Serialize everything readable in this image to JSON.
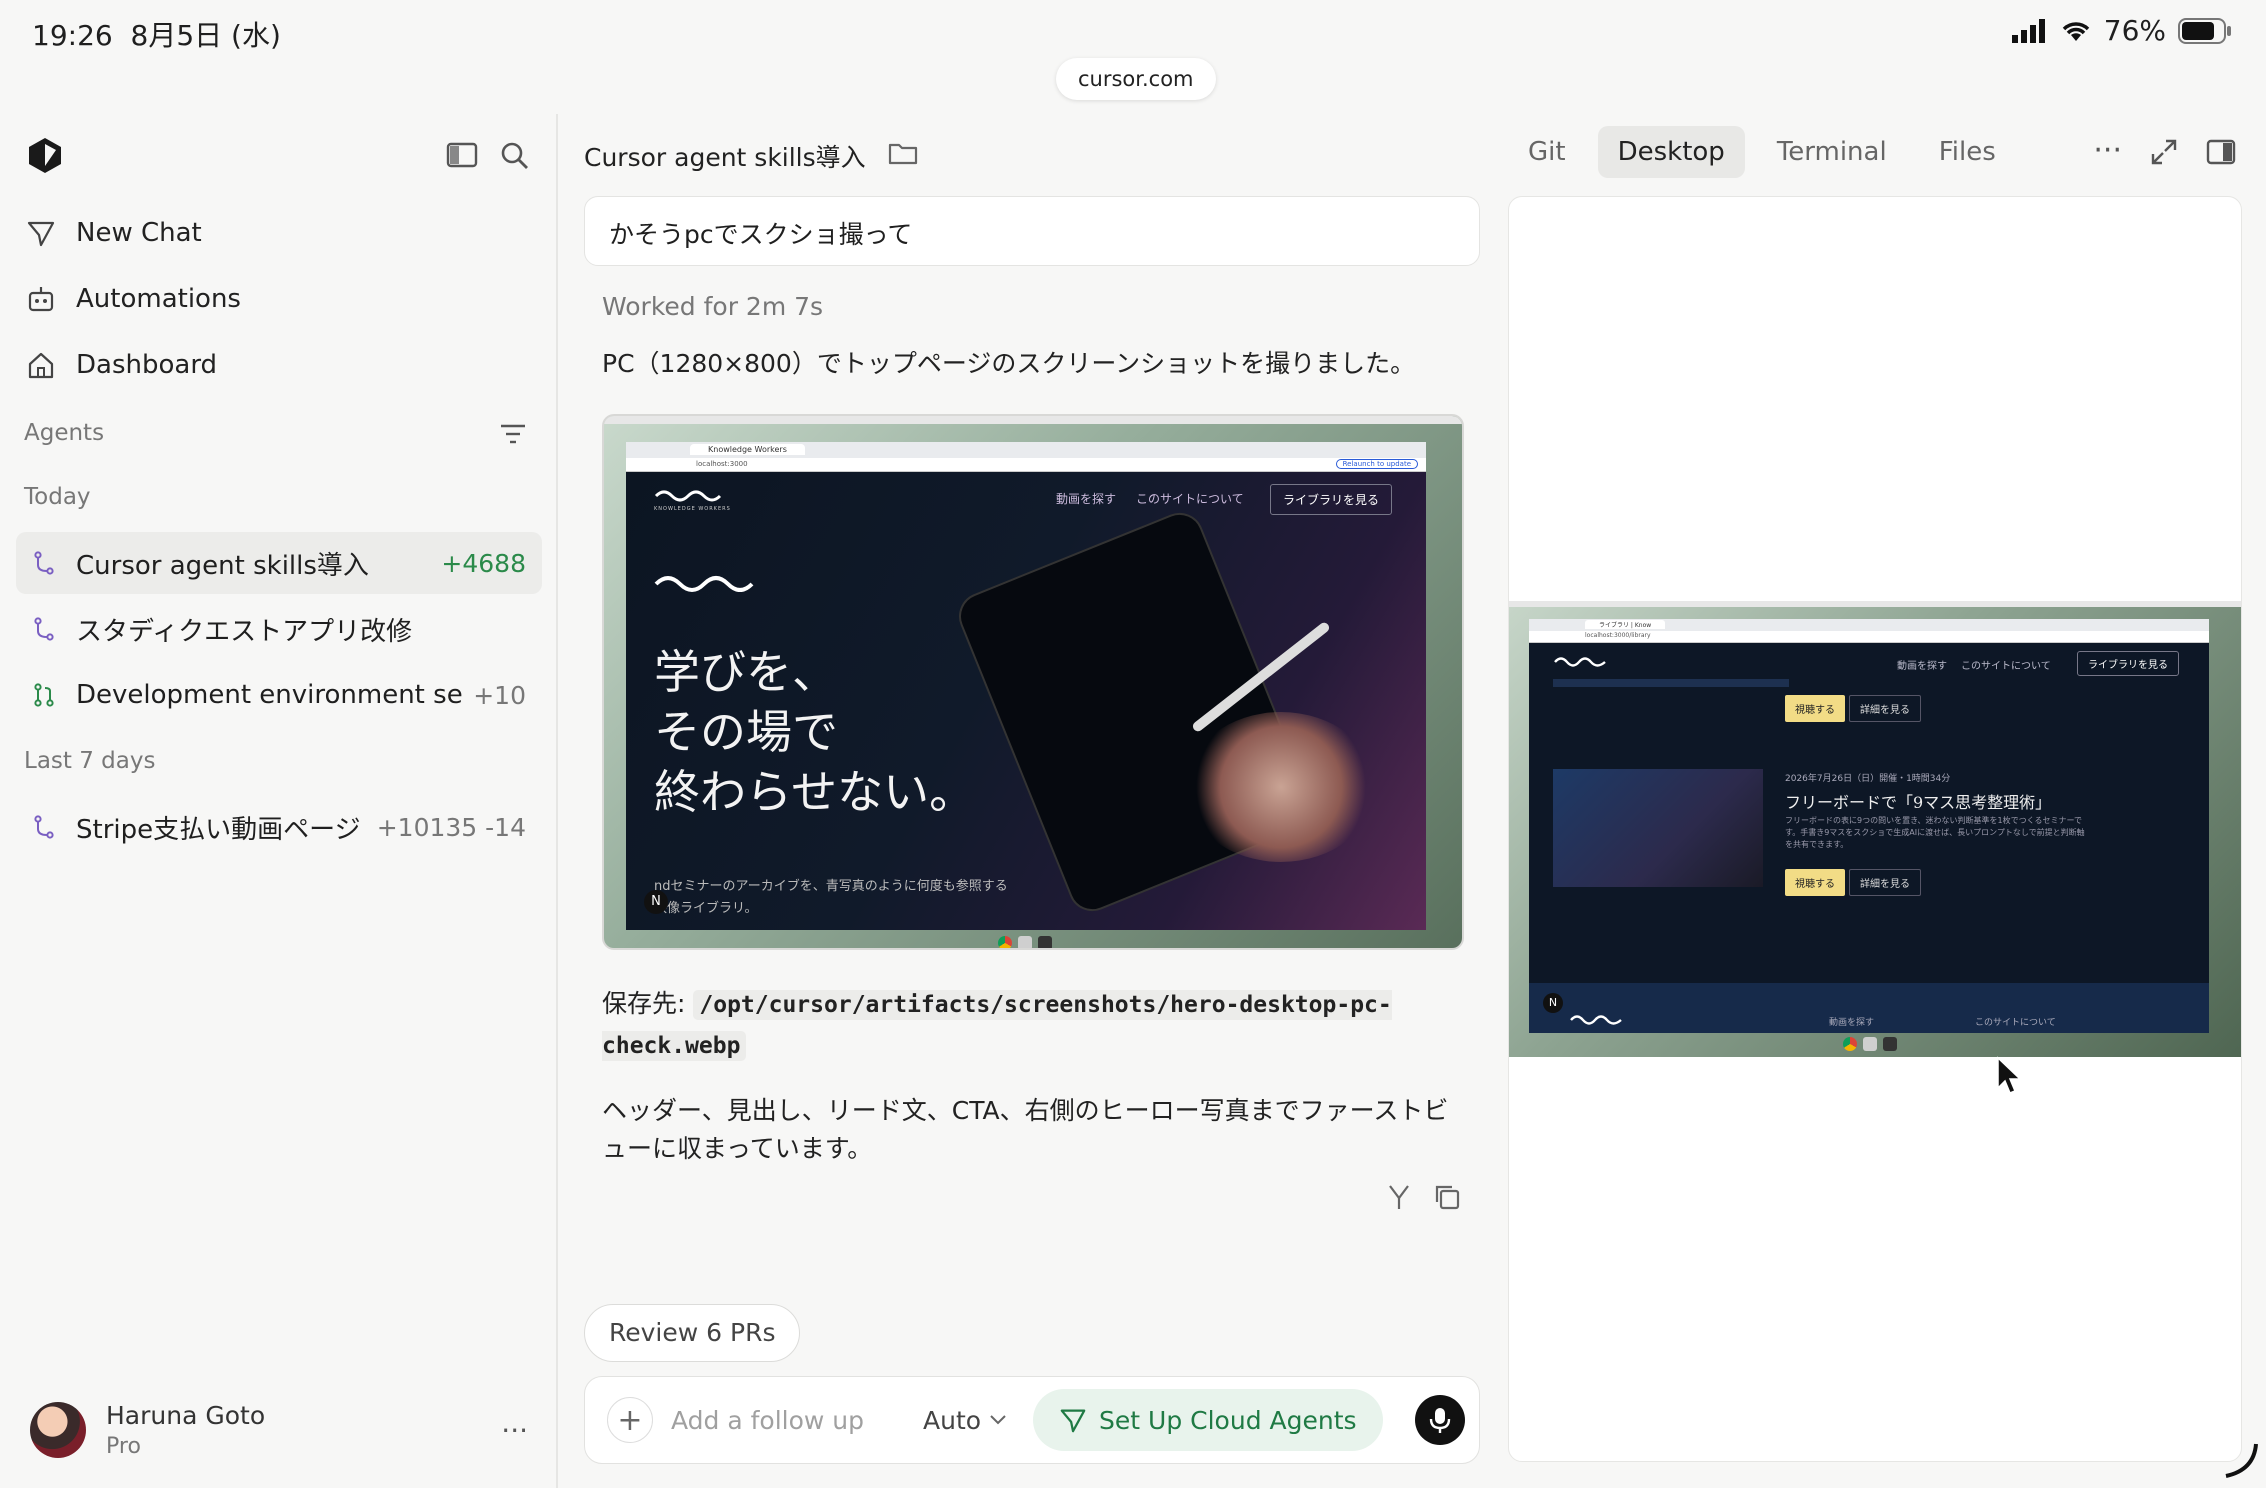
{
  "status": {
    "time": "19:26",
    "date": "8月5日 (水)",
    "battery": "76%",
    "url": "cursor.com"
  },
  "sidebar": {
    "nav": [
      {
        "label": "New Chat",
        "icon": "send-icon"
      },
      {
        "label": "Automations",
        "icon": "robot-icon"
      },
      {
        "label": "Dashboard",
        "icon": "home-icon"
      }
    ],
    "agents_label": "Agents",
    "today_label": "Today",
    "last7_label": "Last 7 days",
    "agents": [
      {
        "title": "Cursor agent skills導入",
        "stat": "+4688"
      },
      {
        "title": "スタディクエストアプリ改修",
        "stat": ""
      },
      {
        "title": "Development environment setup",
        "stat": "+10"
      },
      {
        "title": "Stripe支払い動画ページ",
        "stat": "+10135 -14"
      }
    ],
    "user": {
      "name": "Haruna Goto",
      "plan": "Pro"
    }
  },
  "chat": {
    "title": "Cursor agent skills導入",
    "prompt": "かそうpcでスクショ撮って",
    "worked": "Worked for 2m 7s",
    "message1": "PC（1280×800）でトップページのスクリーンショットを撮りました。",
    "saved_label": "保存先: ",
    "saved_path": "/opt/cursor/artifacts/screenshots/hero-desktop-pc-check.webp",
    "message2": "ヘッダー、見出し、リード文、CTA、右側のヒーロー写真までファーストビューに収まっています。",
    "review_button": "Review 6 PRs",
    "composer_placeholder": "Add a follow up",
    "model": "Auto",
    "cloud_button": "Set Up Cloud Agents"
  },
  "panel": {
    "tabs": [
      "Git",
      "Desktop",
      "Terminal",
      "Files"
    ],
    "active_tab": "Desktop"
  },
  "site1": {
    "tab_title": "Knowledge Workers",
    "address": "localhost:3000",
    "relaunch": "Relaunch to update",
    "brand": "KNOWLEDGE WORKERS",
    "nav": [
      "動画を探す",
      "このサイトについて"
    ],
    "cta": "ライブラリを見る",
    "headline": [
      "学びを、",
      "その場で",
      "終わらせない。"
    ],
    "lead": [
      "ndセミナーのアーカイブを、青写真のように何度も参照する",
      "映像ライブラリ。"
    ]
  },
  "site2": {
    "tab_title": "ライブラリ | Know",
    "address": "localhost:3000/library",
    "watch": "視聴する",
    "detail": "詳細を見る",
    "date": "2026年7月26日（日）開催・1時間34分",
    "title": "フリーボードで「9マス思考整理術」",
    "desc": [
      "フリーボードの表に9つの問いを置き、迷わない判断基準を1枚でつくるセミナーで",
      "す。手書き9マスをスクショで生成AIに渡せば、長いプロンプトなしで前提と判断軸",
      "を共有できます。"
    ],
    "footer_nav": [
      "動画を探す",
      "このサイトについて"
    ]
  },
  "colors": {
    "accent_green": "#2b8a4a",
    "cloud_bg": "#e8f3ec",
    "site_bg": "#0d1726",
    "site_cta_yellow": "#f2dc86"
  }
}
